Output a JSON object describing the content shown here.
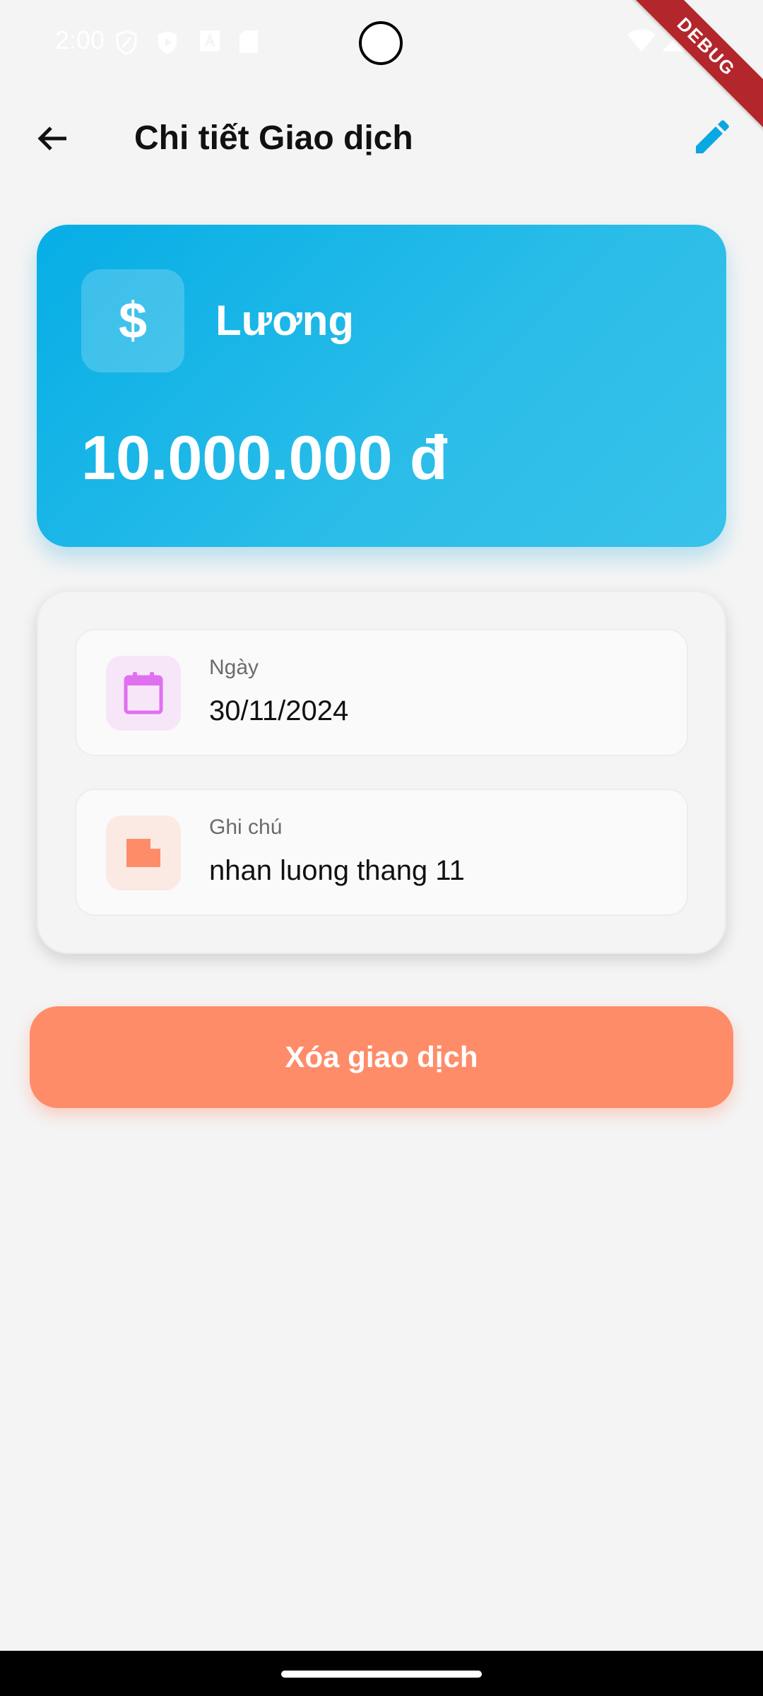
{
  "status_bar": {
    "time": "2:00",
    "left_icons": [
      "shield-icon",
      "play-protect-icon",
      "font-icon",
      "sd-card-icon"
    ],
    "right_icons": [
      "wifi-icon",
      "signal-icon",
      "battery-icon"
    ],
    "debug_label": "DEBUG"
  },
  "app_bar": {
    "title": "Chi tiết Giao dịch",
    "back_icon": "arrow-back-icon",
    "edit_icon": "pencil-icon"
  },
  "hero": {
    "category_icon": "$",
    "category_name": "Lương",
    "amount": "10.000.000 đ"
  },
  "details": [
    {
      "label": "Ngày",
      "value": "30/11/2024",
      "icon": "calendar-icon",
      "icon_color": "#e070f0",
      "icon_bg": "#f6e6f8"
    },
    {
      "label": "Ghi chú",
      "value": "nhan luong thang 11",
      "icon": "note-icon",
      "icon_color": "#ff8c69",
      "icon_bg": "#fbeae4"
    }
  ],
  "actions": {
    "delete_label": "Xóa giao dịch"
  },
  "colors": {
    "accent": "#07aee6",
    "danger": "#ff8c69",
    "background": "#f4f4f4"
  }
}
